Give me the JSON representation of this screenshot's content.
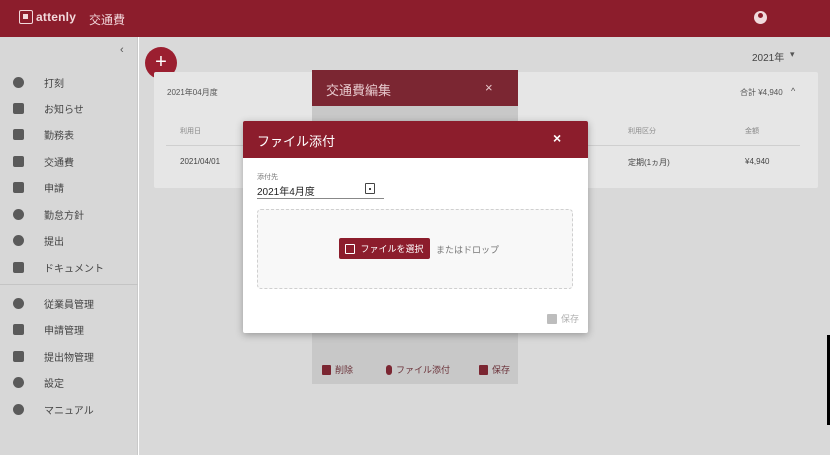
{
  "header": {
    "logo_text": "attenly",
    "title": "交通費",
    "account_icon": "account-circle-icon"
  },
  "sidebar": {
    "collapse_glyph": "‹",
    "items": [
      {
        "label": "打刻",
        "icon": "clock-icon"
      },
      {
        "label": "お知らせ",
        "icon": "clipboard-icon"
      },
      {
        "label": "勤務表",
        "icon": "calendar-icon"
      },
      {
        "label": "交通費",
        "icon": "train-icon"
      },
      {
        "label": "申請",
        "icon": "briefcase-icon"
      },
      {
        "label": "勤怠方針",
        "icon": "compass-icon"
      },
      {
        "label": "提出",
        "icon": "cloud-upload-icon"
      },
      {
        "label": "ドキュメント",
        "icon": "document-icon"
      }
    ],
    "admin_items": [
      {
        "label": "従業員管理",
        "icon": "person-icon"
      },
      {
        "label": "申請管理",
        "icon": "briefcase-check-icon"
      },
      {
        "label": "提出物管理",
        "icon": "folder-person-icon"
      },
      {
        "label": "設定",
        "icon": "gear-icon"
      },
      {
        "label": "マニュアル",
        "icon": "help-icon"
      }
    ]
  },
  "main": {
    "add_glyph": "+",
    "year": "2021年",
    "year_caret": "▾",
    "card": {
      "month": "2021年04月度",
      "total": "合計 ¥4,940",
      "caret": "^",
      "headers": [
        "利用日",
        "利用区分",
        "金額"
      ],
      "row": {
        "date": "2021/04/01",
        "type": "定期(1ヵ月)",
        "amount": "¥4,940"
      }
    }
  },
  "edit_dialog": {
    "title": "交通費編集",
    "close_glyph": "×",
    "actions": {
      "delete": "削除",
      "attach": "ファイル添付",
      "save": "保存"
    }
  },
  "attach_dialog": {
    "title": "ファイル添付",
    "close_glyph": "×",
    "field_label": "添付先",
    "field_value": "2021年4月度",
    "pick_button": "ファイルを選択",
    "or_drop": "またはドロップ",
    "save": "保存"
  },
  "colors": {
    "brand": "#8c1d2c",
    "sidebar": "#d7d7d7"
  }
}
